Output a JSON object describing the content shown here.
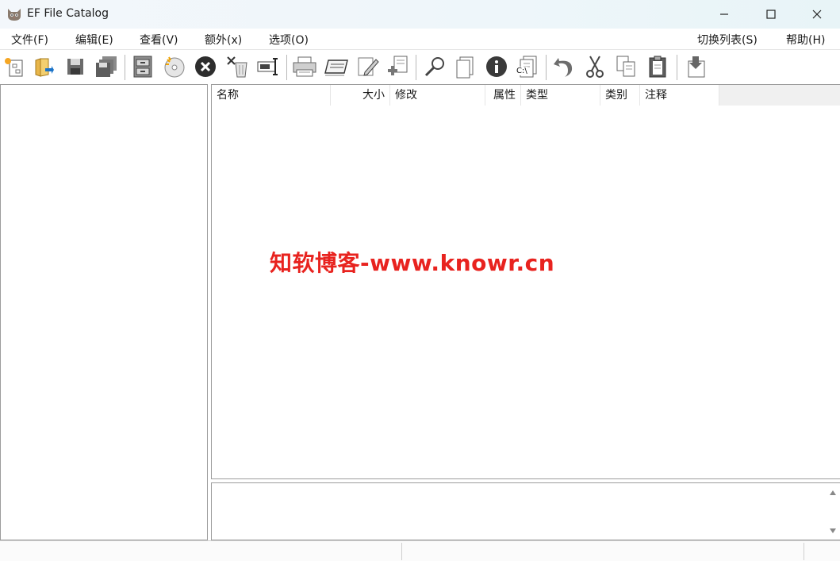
{
  "window": {
    "title": "EF File Catalog",
    "icon": "cat-app-icon"
  },
  "menu": {
    "file": "文件(F)",
    "edit": "编辑(E)",
    "view": "查看(V)",
    "extra": "额外(x)",
    "options": "选项(O)",
    "switch_list": "切换列表(S)",
    "help": "帮助(H)"
  },
  "toolbar": {
    "drive_label": "C:\\"
  },
  "columns": {
    "name": "名称",
    "size": "大小",
    "modified": "修改",
    "attributes": "属性",
    "type": "类型",
    "category": "类别",
    "comment": "注释"
  },
  "watermark": "知软博客-www.knowr.cn",
  "colors": {
    "watermark": "#e8231f",
    "accent": "#1a73c8"
  }
}
